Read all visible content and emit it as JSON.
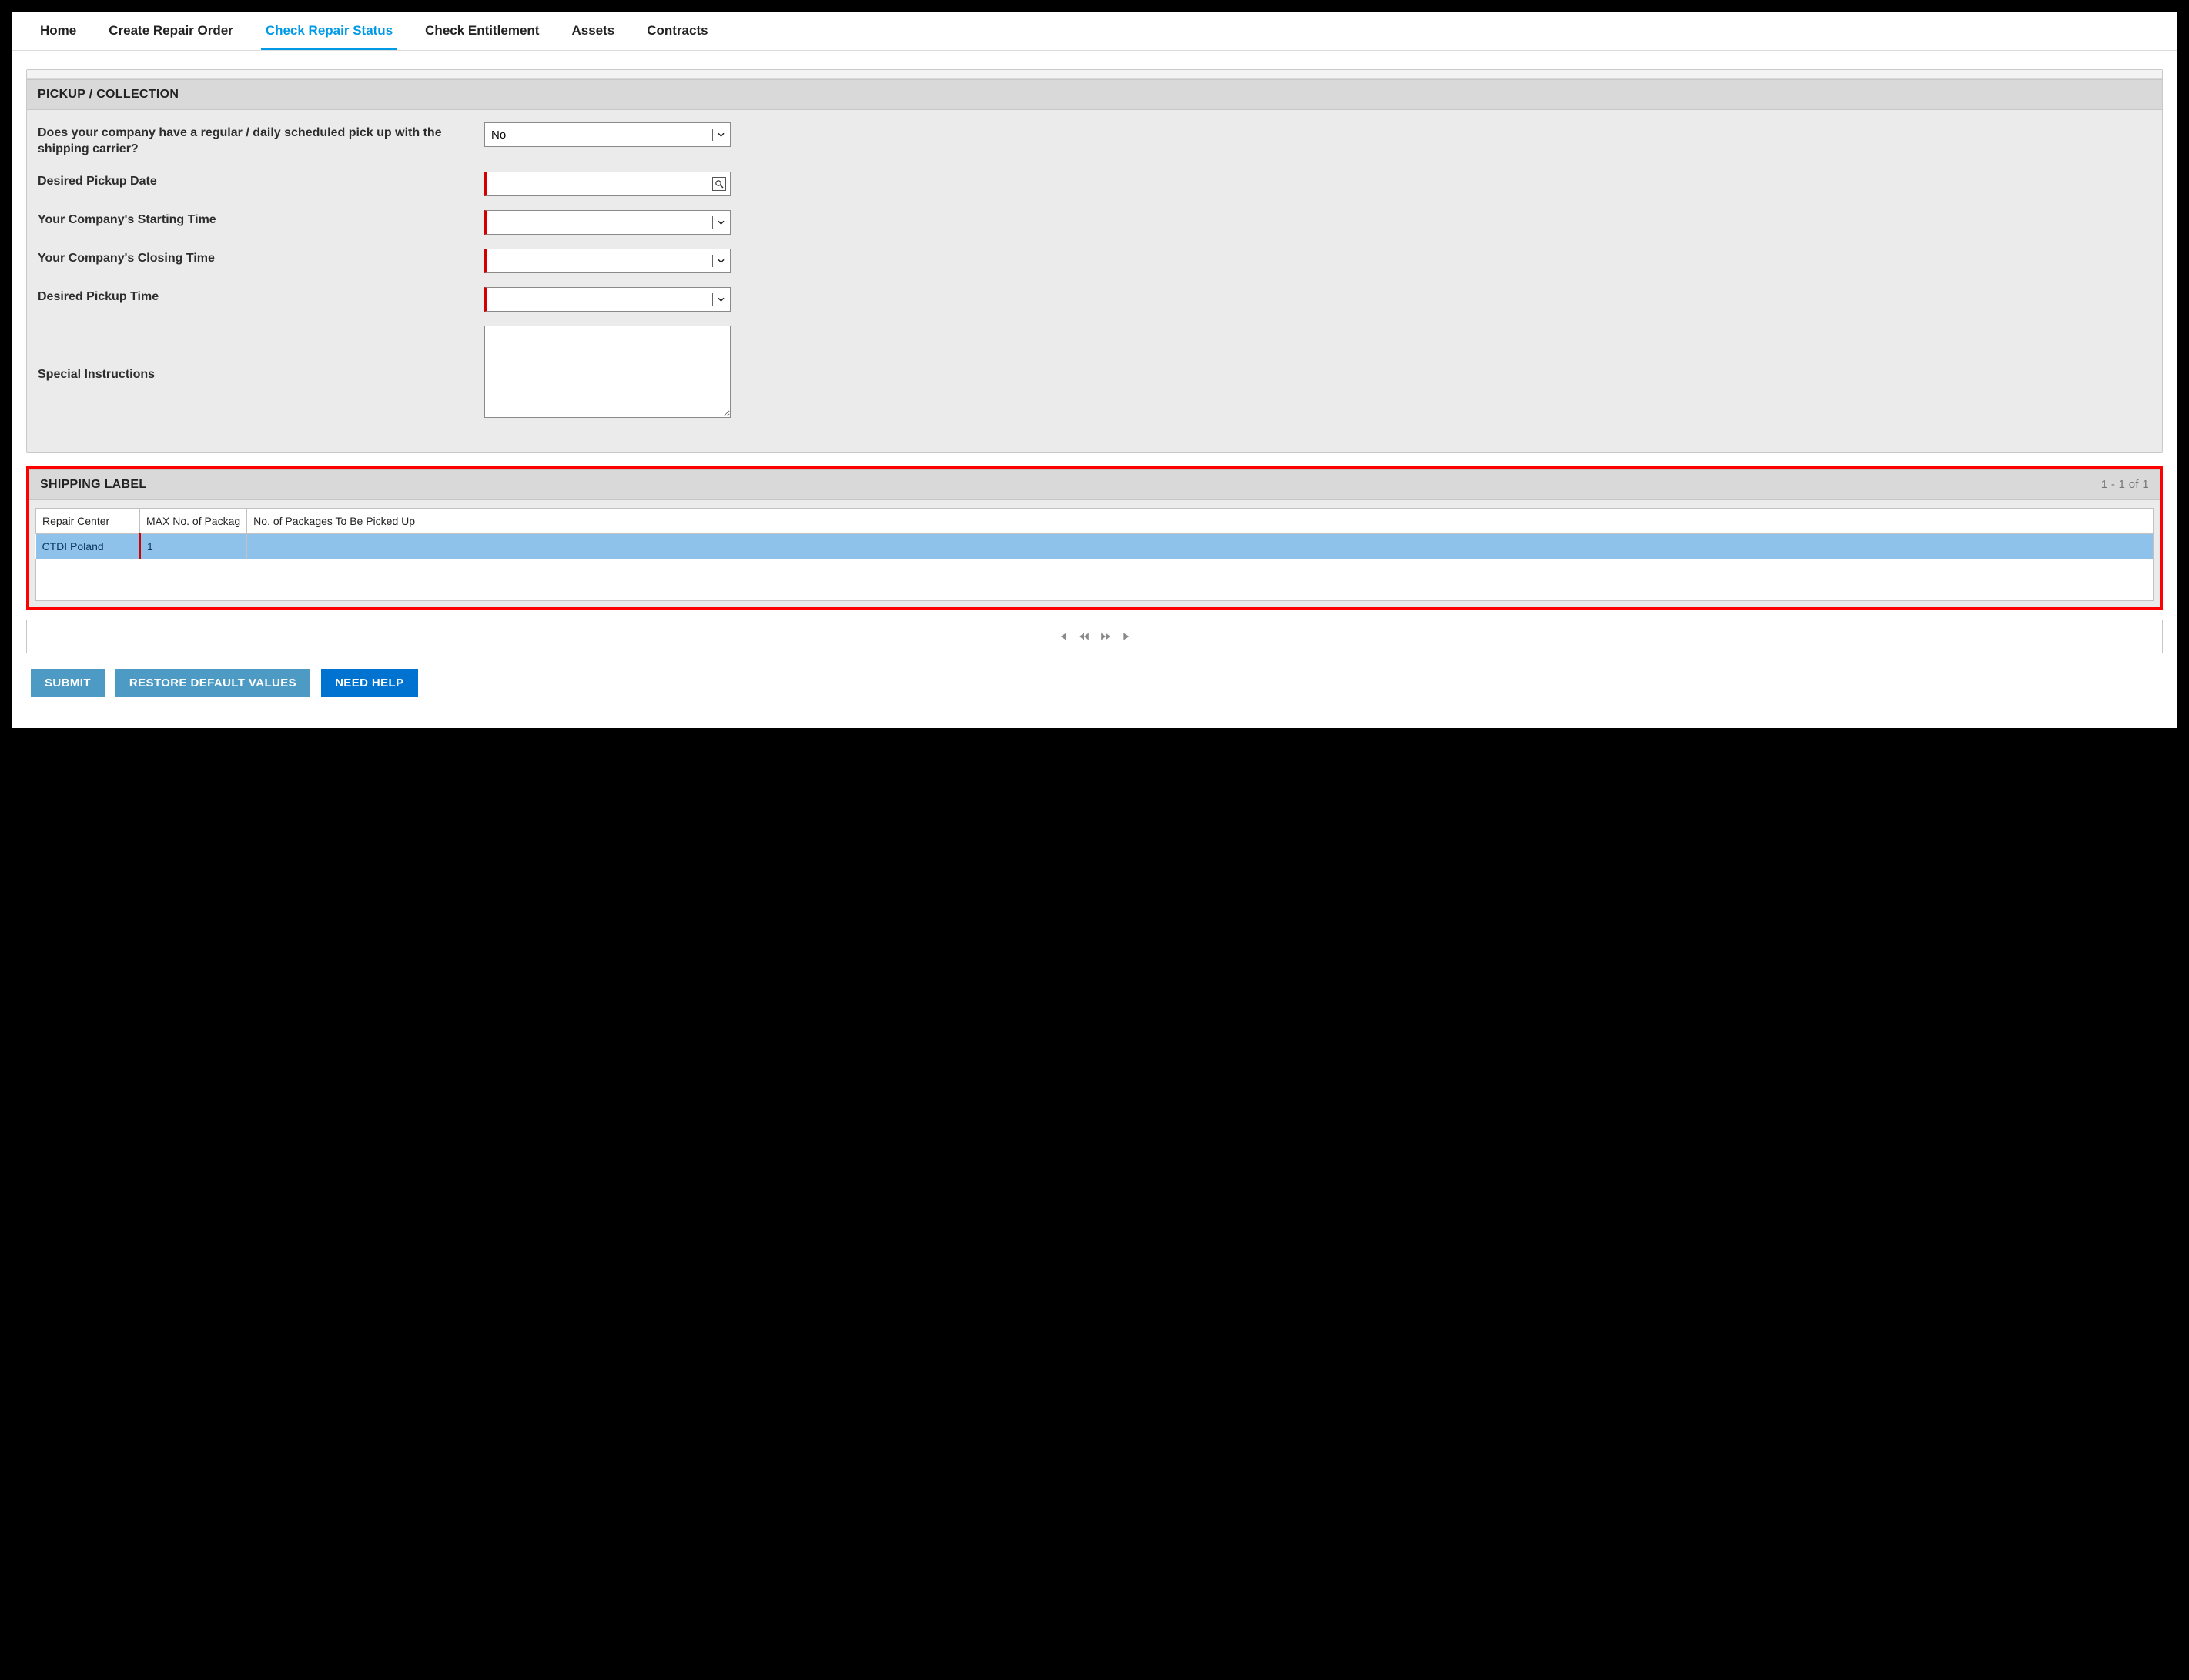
{
  "nav": {
    "items": [
      {
        "label": "Home",
        "active": false
      },
      {
        "label": "Create Repair Order",
        "active": false
      },
      {
        "label": "Check Repair Status",
        "active": true
      },
      {
        "label": "Check Entitlement",
        "active": false
      },
      {
        "label": "Assets",
        "active": false
      },
      {
        "label": "Contracts",
        "active": false
      }
    ]
  },
  "pickup": {
    "title": "PICKUP / COLLECTION",
    "fields": {
      "scheduled_question": "Does your company have a regular / daily scheduled pick up with the shipping carrier?",
      "scheduled_value": "No",
      "date_label": "Desired Pickup Date",
      "date_value": "",
      "start_label": "Your Company's Starting Time",
      "start_value": "",
      "close_label": "Your Company's Closing Time",
      "close_value": "",
      "time_label": "Desired Pickup Time",
      "time_value": "",
      "special_label": "Special Instructions",
      "special_value": ""
    }
  },
  "shipping": {
    "title": "SHIPPING LABEL",
    "count_text": "1 - 1 of 1",
    "columns": [
      "Repair Center",
      "MAX No. of Packag",
      "No. of Packages To Be Picked Up"
    ],
    "rows": [
      {
        "repair_center": "CTDI Poland",
        "max_packages": "1",
        "to_pickup": ""
      }
    ]
  },
  "buttons": {
    "submit": "SUBMIT",
    "restore": "RESTORE DEFAULT VALUES",
    "help": "NEED HELP"
  }
}
